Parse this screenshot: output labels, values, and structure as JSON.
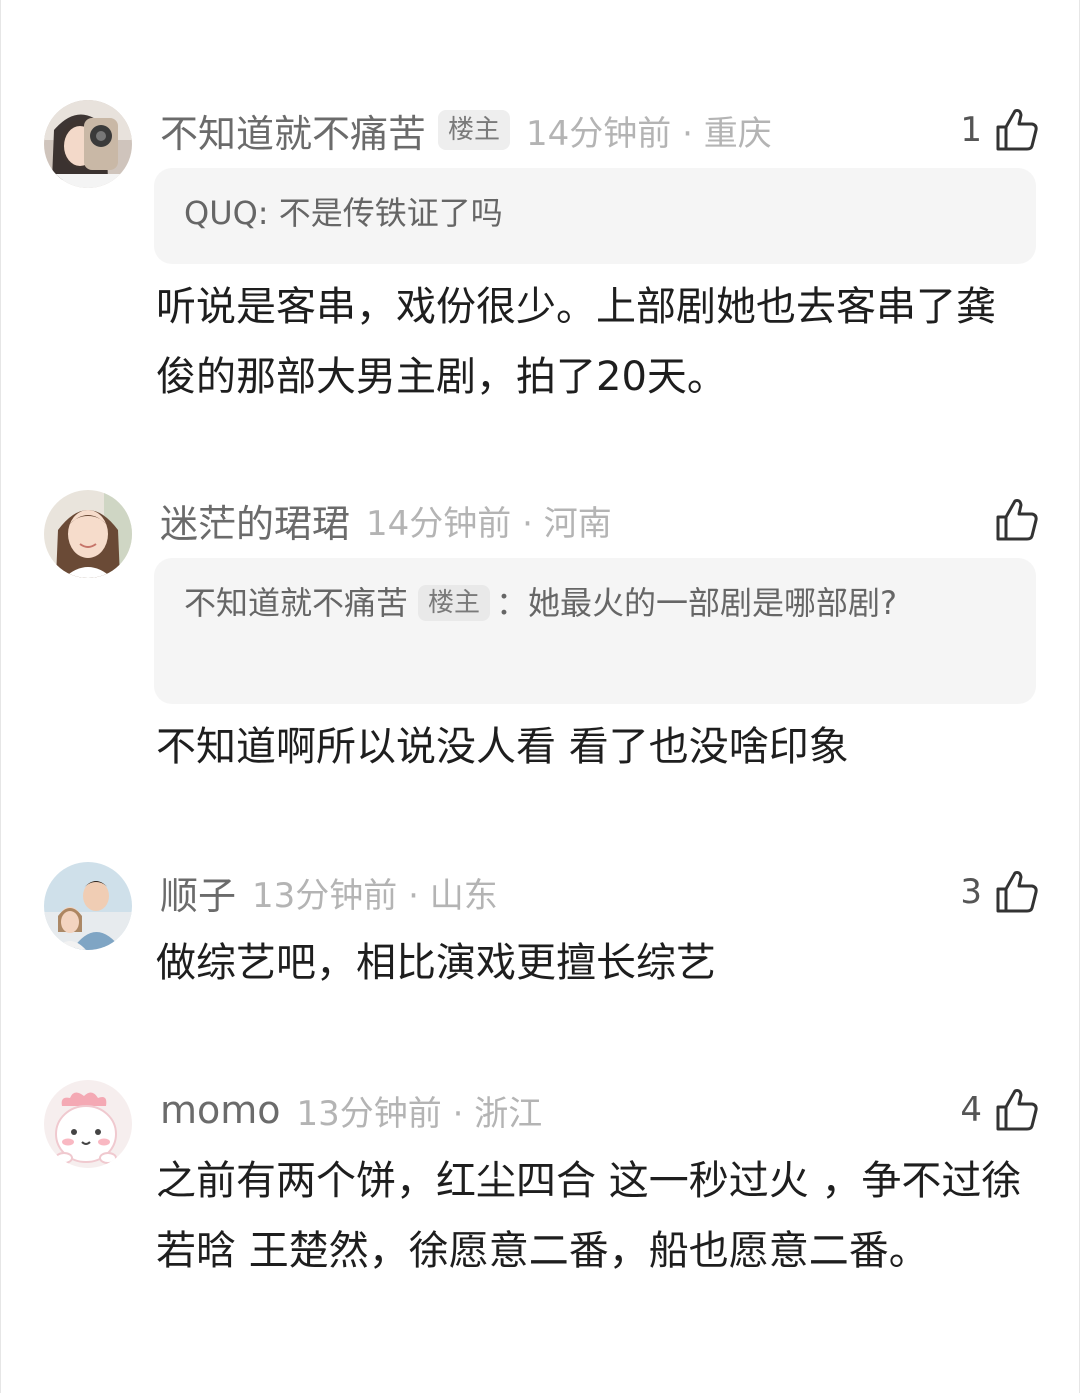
{
  "comments": [
    {
      "username": "不知道就不痛苦",
      "badge": "楼主",
      "meta": "14分钟前 · 重庆",
      "likes": "1",
      "quote": {
        "author": "QUQ",
        "separator": ": ",
        "text": "不是传铁证了吗"
      },
      "text": "听说是客串，戏份很少。上部剧她也去客串了龚俊的那部大男主剧，拍了20天。"
    },
    {
      "username": "迷茫的珺珺",
      "meta": "14分钟前 · 河南",
      "likes": "",
      "quote": {
        "author": "不知道就不痛苦",
        "badge": "楼主",
        "separator": "：",
        "text": "她最火的一部剧是哪部剧?"
      },
      "text": "不知道啊所以说没人看 看了也没啥印象"
    },
    {
      "username": "顺子",
      "meta": "13分钟前 · 山东",
      "likes": "3",
      "text": "做综艺吧，相比演戏更擅长综艺"
    },
    {
      "username": "momo",
      "meta": "13分钟前 · 浙江",
      "likes": "4",
      "text": "之前有两个饼，红尘四合 这一秒过火 ，争不过徐若晗 王楚然，徐愿意二番，船也愿意二番。"
    }
  ]
}
